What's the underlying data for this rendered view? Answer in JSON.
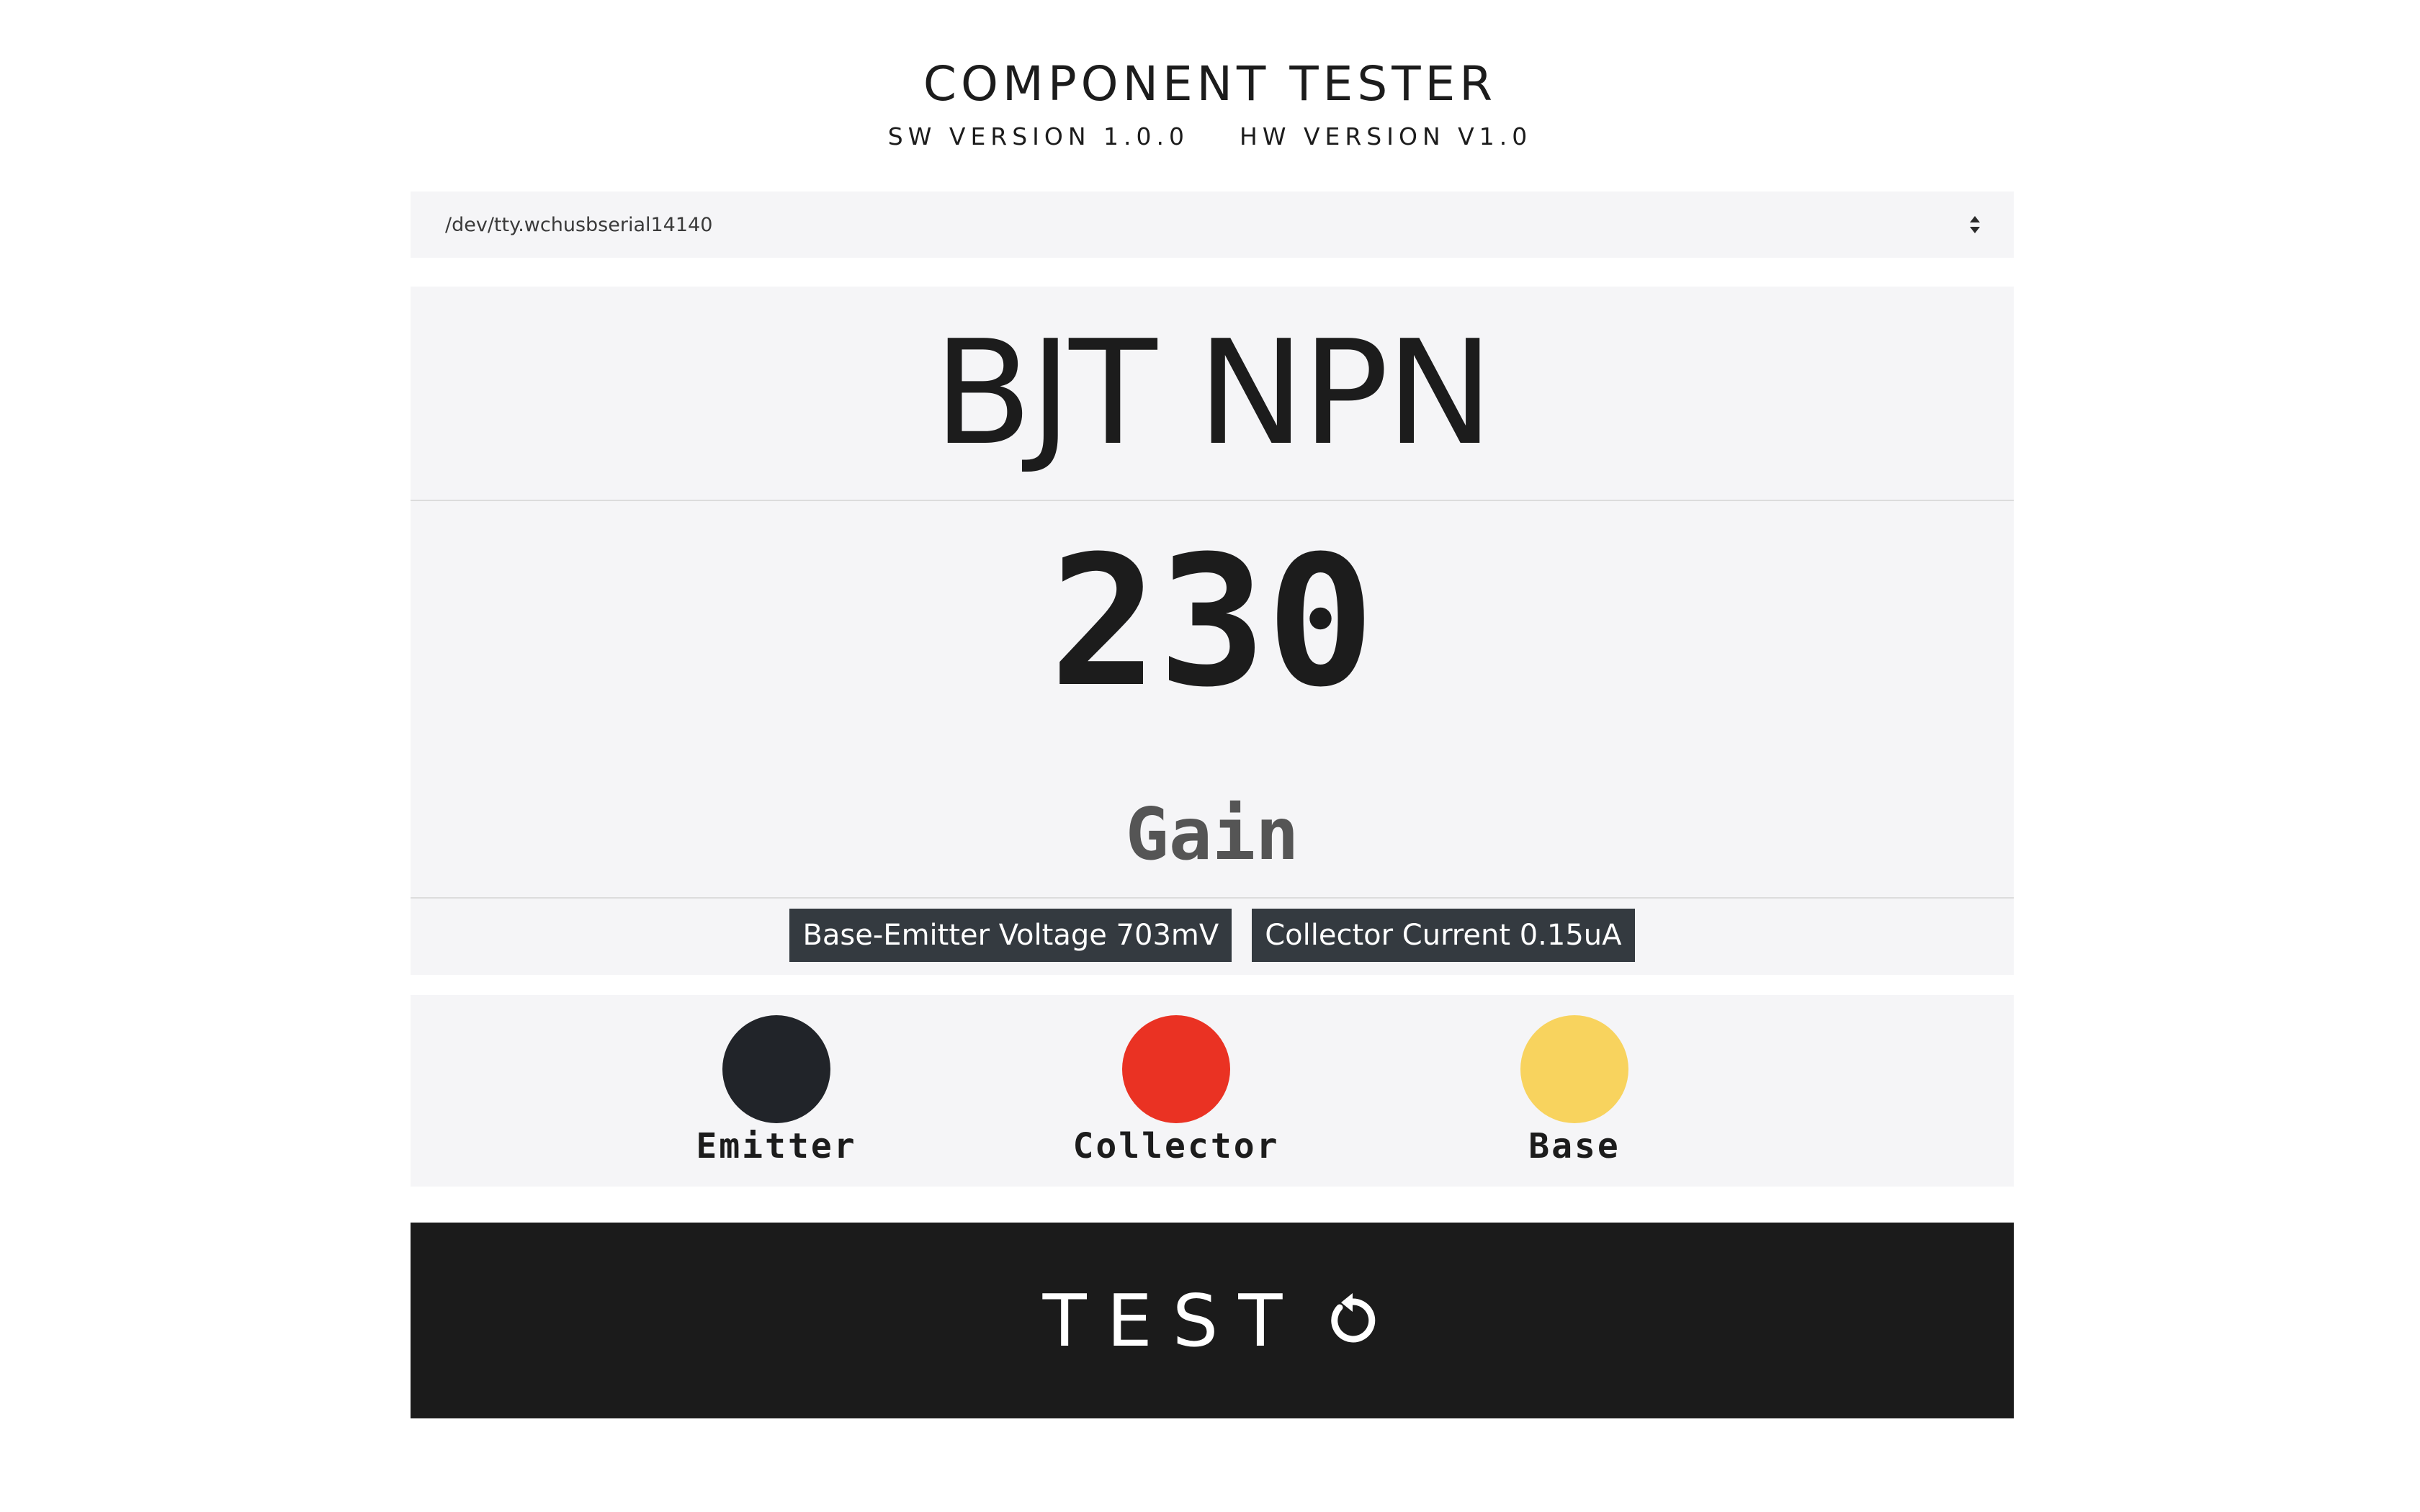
{
  "header": {
    "title": "COMPONENT TESTER",
    "sw_version": "SW VERSION 1.0.0",
    "hw_version": "HW VERSION V1.0"
  },
  "port": {
    "selected": "/dev/tty.wchusbserial14140",
    "icon": "select-arrows-icon"
  },
  "result": {
    "component_type": "BJT NPN",
    "gain_value": "230",
    "gain_label": "Gain",
    "badges": [
      {
        "label": "Base-Emitter Voltage 703mV"
      },
      {
        "label": "Collector Current 0.15uA"
      }
    ]
  },
  "pins": [
    {
      "label": "Emitter",
      "color": "#212429"
    },
    {
      "label": "Collector",
      "color": "#ea3223"
    },
    {
      "label": "Base",
      "color": "#f8d35e"
    }
  ],
  "test_button": {
    "label": "TEST",
    "icon": "refresh-icon"
  }
}
